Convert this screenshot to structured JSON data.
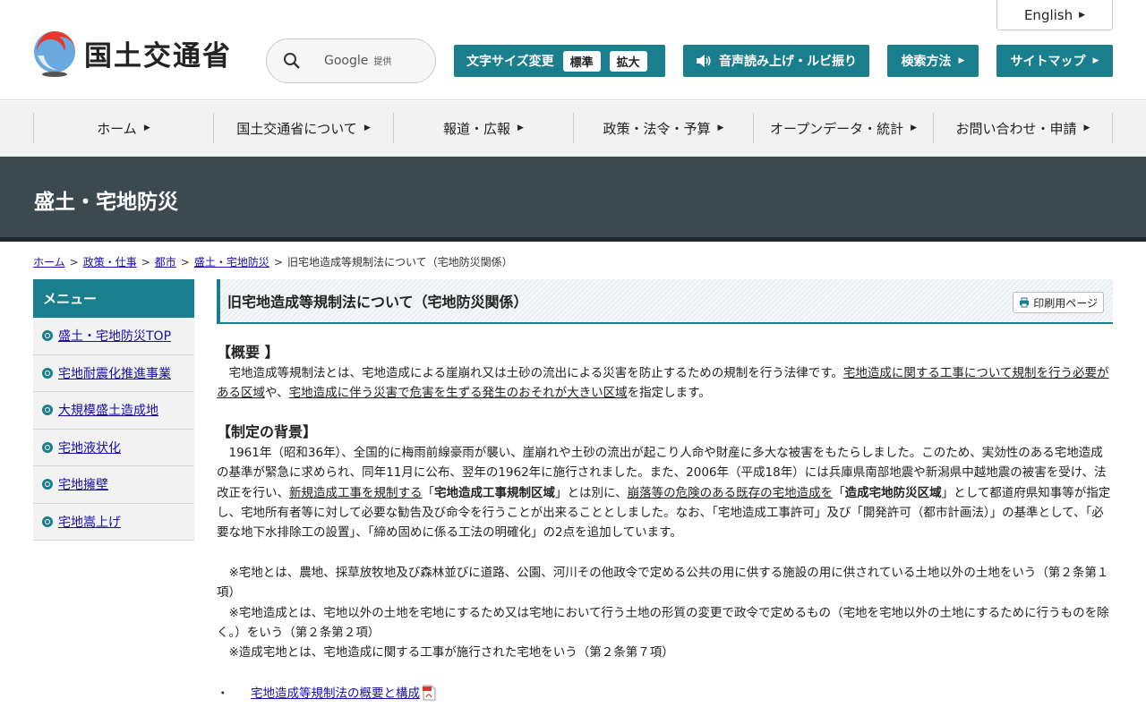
{
  "header": {
    "logo_text": "国土交通省",
    "search": {
      "brand": "Google",
      "provider": "提供"
    },
    "english_label": "English",
    "font_size": {
      "label": "文字サイズ変更",
      "normal": "標準",
      "large": "拡大"
    },
    "voice_label": "音声読み上げ・ルビ振り",
    "search_howto_label": "検索方法",
    "sitemap_label": "サイトマップ"
  },
  "gnav": [
    {
      "label": "ホーム"
    },
    {
      "label": "国土交通省について"
    },
    {
      "label": "報道・広報"
    },
    {
      "label": "政策・法令・予算"
    },
    {
      "label": "オープンデータ・統計"
    },
    {
      "label": "お問い合わせ・申請"
    }
  ],
  "banner": {
    "title": "盛土・宅地防災"
  },
  "breadcrumb": {
    "items": [
      "ホーム",
      "政策・仕事",
      "都市",
      "盛土・宅地防災"
    ],
    "current": "旧宅地造成等規制法について（宅地防災関係）"
  },
  "side_menu": {
    "heading": "メニュー",
    "items": [
      "盛土・宅地防災TOP",
      "宅地耐震化推進事業",
      "大規模盛土造成地",
      "宅地液状化",
      "宅地擁壁",
      "宅地嵩上げ"
    ]
  },
  "main": {
    "title": "旧宅地造成等規制法について（宅地防災関係）",
    "print_label": "印刷用ページ",
    "overview": {
      "heading": "【概要 】",
      "t1": "宅地造成等規制法とは、宅地造成による崖崩れ又は土砂の流出による災害を防止するための規制を行う法律です。",
      "l1": "宅地造成に関する工事について規制を行う必要がある区域",
      "t2": "や、",
      "l2": "宅地造成に伴う災害で危害を生ずる発生のおそれが大きい区域",
      "t3": "を指定します。"
    },
    "background": {
      "heading": "【制定の背景】",
      "t1": "1961年（昭和36年）、全国的に梅雨前線豪雨が襲い、崖崩れや土砂の流出が起こり人命や財産に多大な被害をもたらしました。このため、実効性のある宅地造成の基準が緊急に求められ、同年11月に公布、翌年の1962年に施行されました。また、2006年（平成18年）には兵庫県南部地震や新潟県中越地震の被害を受け、法改正を行い、",
      "l1": "新規造成工事を規制する",
      "q1": "「",
      "b1": "宅地造成工事規制区域",
      "t2": "」とは別に、",
      "l2": "崩落等の危険のある既存の宅地造成を",
      "q2": "「",
      "b2": "造成宅地防災区域",
      "t3": "」として都道府県知事等が指定し、宅地所有者等に対して必要な勧告及び命令を行うことが出来ることとしました。なお、「宅地造成工事許可」及び「開発許可（都市計画法）」の基準として、「必要な地下水排除工の設置」、「締め固めに係る工法の明確化」の2点を追加しています。"
    },
    "notes": [
      "※宅地とは、農地、採草放牧地及び森林並びに道路、公園、河川その他政令で定める公共の用に供する施設の用に供されている土地以外の土地をいう（第２条第１項）",
      "※宅地造成とは、宅地以外の土地を宅地にするため又は宅地において行う土地の形質の変更で政令で定めるもの（宅地を宅地以外の土地にするために行うものを除く。）をいう（第２条第２項）",
      "※造成宅地とは、宅地造成に関する工事が施行された宅地をいう（第２条第７項）"
    ],
    "links": [
      {
        "label": "宅地造成等規制法の概要と構成"
      }
    ]
  },
  "colors": {
    "accent": "#1a7f8c",
    "banner": "#3c4a4f"
  }
}
